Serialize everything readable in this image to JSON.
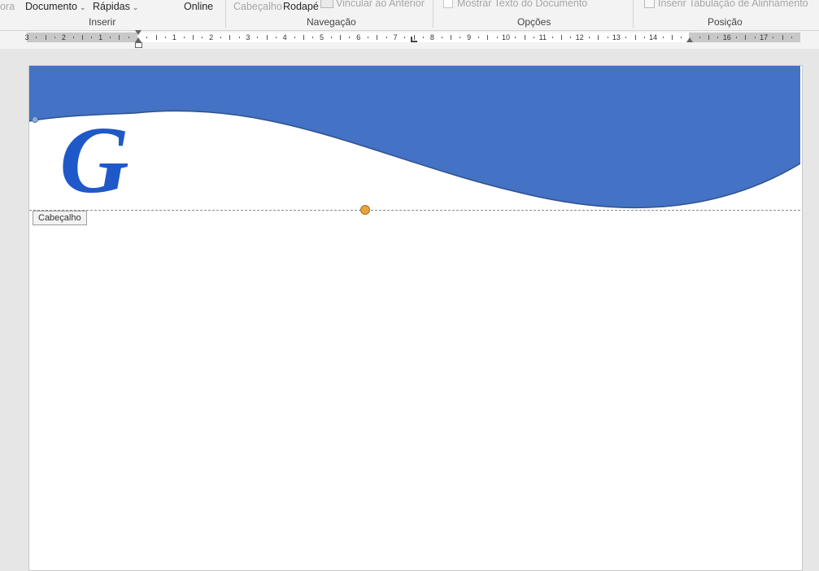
{
  "ribbon": {
    "partial_left": "ora",
    "documento": "Documento",
    "rapidas": "Rápidas",
    "online": "Online",
    "cabecalho": "Cabeçalho",
    "rodape": "Rodapé",
    "vincular": "Vincular ao Anterior",
    "mostrar": "Mostrar Texto do Documento",
    "inserir_tab": "Inserir Tabulação de Alinhamento",
    "groups": {
      "inserir": "Inserir",
      "navegacao": "Navegação",
      "opcoes": "Opções",
      "posicao": "Posição"
    },
    "chevron": "⌄"
  },
  "ruler": {
    "left_numbers": [
      "3",
      "2",
      "1"
    ],
    "right_numbers": [
      "1",
      "2",
      "3",
      "4",
      "5",
      "6",
      "7",
      "8",
      "9",
      "10",
      "11",
      "12",
      "13",
      "14"
    ],
    "margin_numbers": [
      "16",
      "17"
    ]
  },
  "header": {
    "label": "Cabeçalho",
    "logo_letter": "G"
  },
  "colors": {
    "header_blue": "#4472c4",
    "logo_blue": "#1f58c9"
  }
}
